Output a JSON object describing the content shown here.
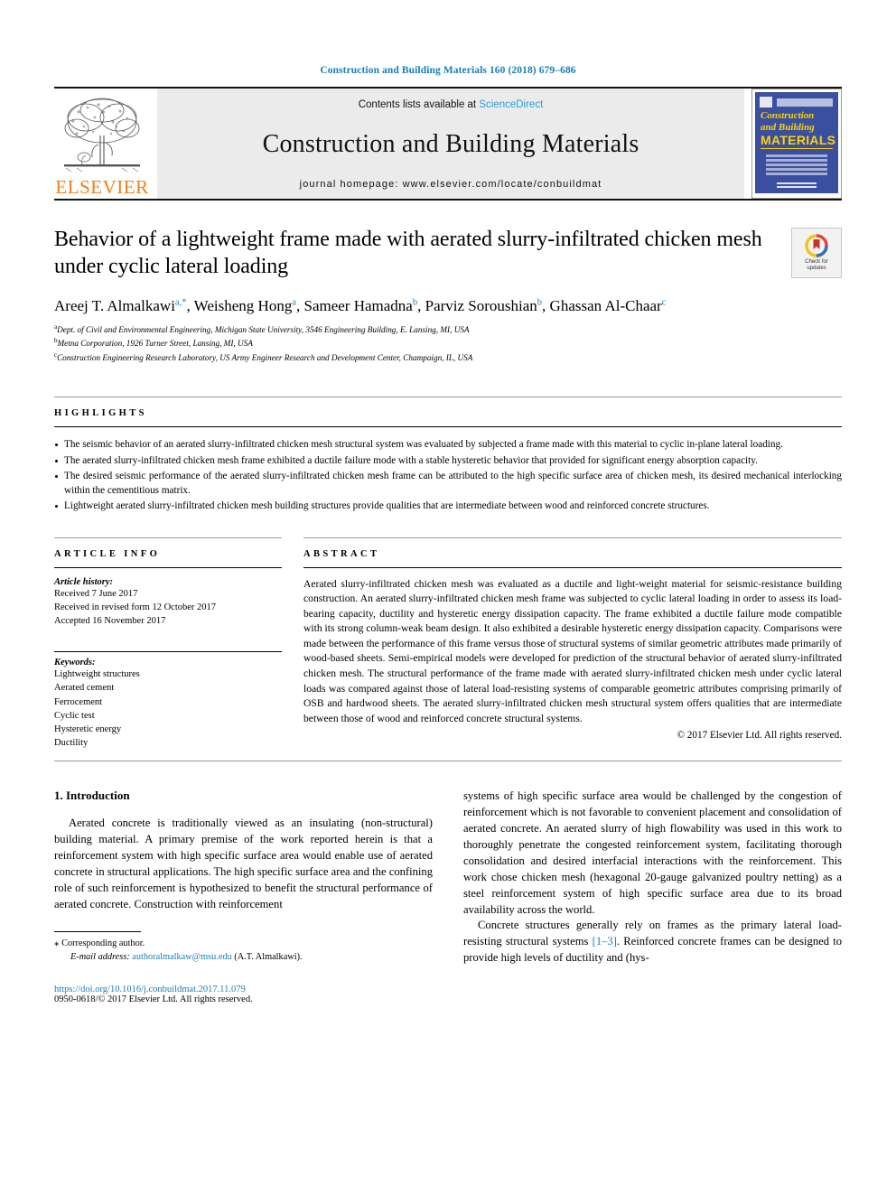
{
  "running_head": "Construction and Building Materials 160 (2018) 679–686",
  "masthead": {
    "publisher_logo_text": "ELSEVIER",
    "contents_prefix": "Contents lists available at ",
    "contents_link": "ScienceDirect",
    "journal_name": "Construction and Building Materials",
    "homepage_line": "journal homepage: www.elsevier.com/locate/conbuildmat",
    "cover": {
      "line1": "Construction",
      "line2": "and Building",
      "line3": "MATERIALS"
    }
  },
  "crossmark": {
    "line1": "Check for",
    "line2": "updates"
  },
  "article": {
    "title": "Behavior of a lightweight frame made with aerated slurry-infiltrated chicken mesh under cyclic lateral loading",
    "authors": [
      {
        "name": "Areej T. Almalkawi",
        "marks": "a,*",
        "sep": ", "
      },
      {
        "name": "Weisheng Hong",
        "marks": "a",
        "sep": ", "
      },
      {
        "name": "Sameer Hamadna",
        "marks": "b",
        "sep": ", "
      },
      {
        "name": "Parviz Soroushian",
        "marks": "b",
        "sep": ", "
      },
      {
        "name": "Ghassan Al-Chaar",
        "marks": "c",
        "sep": ""
      }
    ],
    "affiliations": [
      {
        "mark": "a",
        "text": "Dept. of Civil and Environmental Engineering, Michigan State University, 3546 Engineering Building, E. Lansing, MI, USA"
      },
      {
        "mark": "b",
        "text": "Metna Corporation, 1926 Turner Street, Lansing, MI, USA"
      },
      {
        "mark": "c",
        "text": "Construction Engineering Research Laboratory, US Army Engineer Research and Development Center, Champaign, IL, USA"
      }
    ]
  },
  "highlights": {
    "label": "HIGHLIGHTS",
    "items": [
      "The seismic behavior of an aerated slurry-infiltrated chicken mesh structural system was evaluated by subjected a frame made with this material to cyclic in-plane lateral loading.",
      "The aerated slurry-infiltrated chicken mesh frame exhibited a ductile failure mode with a stable hysteretic behavior that provided for significant energy absorption capacity.",
      "The desired seismic performance of the aerated slurry-infiltrated chicken mesh frame can be attributed to the high specific surface area of chicken mesh, its desired mechanical interlocking within the cementitious matrix.",
      "Lightweight aerated slurry-infiltrated chicken mesh building structures provide qualities that are intermediate between wood and reinforced concrete structures."
    ]
  },
  "article_info": {
    "label": "ARTICLE INFO",
    "history_title": "Article history:",
    "history": [
      "Received 7 June 2017",
      "Received in revised form 12 October 2017",
      "Accepted 16 November 2017"
    ],
    "keywords_title": "Keywords:",
    "keywords": [
      "Lightweight structures",
      "Aerated cement",
      "Ferrocement",
      "Cyclic test",
      "Hysteretic energy",
      "Ductility"
    ]
  },
  "abstract": {
    "label": "ABSTRACT",
    "text": "Aerated slurry-infiltrated chicken mesh was evaluated as a ductile and light-weight material for seismic-resistance building construction. An aerated slurry-infiltrated chicken mesh frame was subjected to cyclic lateral loading in order to assess its load-bearing capacity, ductility and hysteretic energy dissipation capacity. The frame exhibited a ductile failure mode compatible with its strong column-weak beam design. It also exhibited a desirable hysteretic energy dissipation capacity. Comparisons were made between the performance of this frame versus those of structural systems of similar geometric attributes made primarily of wood-based sheets. Semi-empirical models were developed for prediction of the structural behavior of aerated slurry-infiltrated chicken mesh. The structural performance of the frame made with aerated slurry-infiltrated chicken mesh under cyclic lateral loads was compared against those of lateral load-resisting systems of comparable geometric attributes comprising primarily of OSB and hardwood sheets. The aerated slurry-infiltrated chicken mesh structural system offers qualities that are intermediate between those of wood and reinforced concrete structural systems.",
    "copyright": "© 2017 Elsevier Ltd. All rights reserved."
  },
  "body": {
    "section_heading": "1. Introduction",
    "left_paragraphs": [
      "Aerated concrete is traditionally viewed as an insulating (non-structural) building material. A primary premise of the work reported herein is that a reinforcement system with high specific surface area would enable use of aerated concrete in structural applications. The high specific surface area and the confining role of such reinforcement is hypothesized to benefit the structural performance of aerated concrete. Construction with reinforcement"
    ],
    "right_paragraphs": [
      "systems of high specific surface area would be challenged by the congestion of reinforcement which is not favorable to convenient placement and consolidation of aerated concrete. An aerated slurry of high flowability was used in this work to thoroughly penetrate the congested reinforcement system, facilitating thorough consolidation and desired interfacial interactions with the reinforcement. This work chose chicken mesh (hexagonal 20-gauge galvanized poultry netting) as a steel reinforcement system of high specific surface area due to its broad availability across the world."
    ],
    "right_paragraph_2_pre": "Concrete structures generally rely on frames as the primary lateral load-resisting structural systems ",
    "right_paragraph_2_ref": "[1–3]",
    "right_paragraph_2_post": ". Reinforced concrete frames can be designed to provide high levels of ductility and (hys-"
  },
  "footnote": {
    "corresponding": "Corresponding author.",
    "email_label": "E-mail address:",
    "email": "authoralmalkaw@msu.edu",
    "email_suffix": "(A.T. Almalkawi).",
    "doi": "https://doi.org/10.1016/j.conbuildmat.2017.11.079",
    "issn": "0950-0618/© 2017 Elsevier Ltd. All rights reserved."
  },
  "colors": {
    "link_blue": "#1a7db8",
    "science_direct_blue": "#2a9fd6",
    "elsevier_orange": "#ef7f1a",
    "cover_blue": "#3b4fa0",
    "cover_yellow": "#ffd200"
  }
}
